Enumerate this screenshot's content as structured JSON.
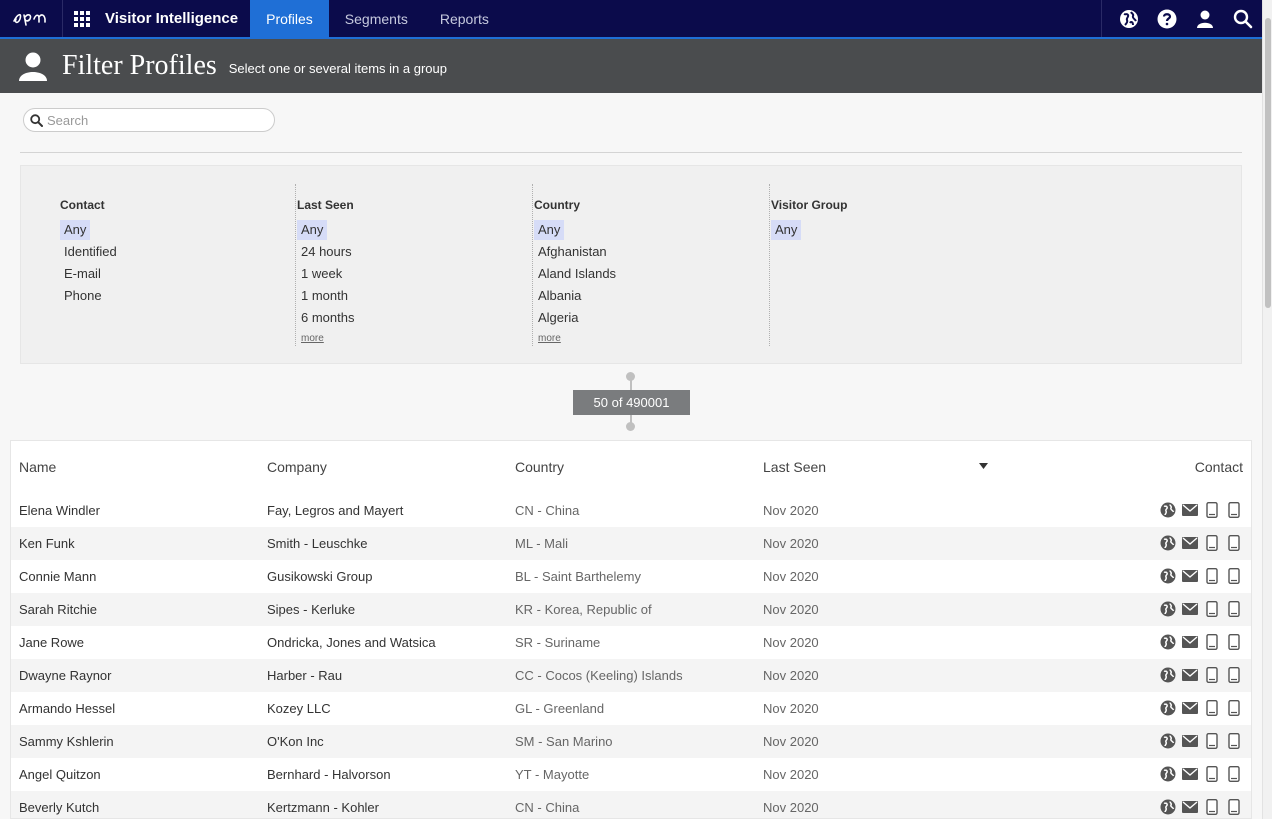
{
  "nav": {
    "product": "Visitor Intelligence",
    "tabs": [
      {
        "label": "Profiles",
        "active": true
      },
      {
        "label": "Segments",
        "active": false
      },
      {
        "label": "Reports",
        "active": false
      }
    ],
    "icons": [
      "globe-icon",
      "help-icon",
      "user-icon",
      "search-icon"
    ]
  },
  "header": {
    "title": "Filter Profiles",
    "subtitle": "Select one or several items in a group"
  },
  "search": {
    "placeholder": "Search",
    "value": ""
  },
  "filters": [
    {
      "title": "Contact",
      "items": [
        "Any",
        "Identified",
        "E-mail",
        "Phone"
      ],
      "selected": "Any",
      "more": ""
    },
    {
      "title": "Last Seen",
      "items": [
        "Any",
        "24 hours",
        "1 week",
        "1 month",
        "6 months"
      ],
      "selected": "Any",
      "more": "more"
    },
    {
      "title": "Country",
      "items": [
        "Any",
        "Afghanistan",
        "Aland Islands",
        "Albania",
        "Algeria"
      ],
      "selected": "Any",
      "more": "more"
    },
    {
      "title": "Visitor Group",
      "items": [
        "Any"
      ],
      "selected": "Any",
      "more": ""
    }
  ],
  "counter": "50 of 490001",
  "table": {
    "headers": {
      "name": "Name",
      "company": "Company",
      "country": "Country",
      "last_seen": "Last Seen",
      "contact": "Contact"
    },
    "rows": [
      {
        "name": "Elena Windler",
        "company": "Fay, Legros and Mayert",
        "country": "CN - China",
        "last_seen": "Nov 2020"
      },
      {
        "name": "Ken Funk",
        "company": "Smith - Leuschke",
        "country": "ML - Mali",
        "last_seen": "Nov 2020"
      },
      {
        "name": "Connie Mann",
        "company": "Gusikowski Group",
        "country": "BL - Saint Barthelemy",
        "last_seen": "Nov 2020"
      },
      {
        "name": "Sarah Ritchie",
        "company": "Sipes - Kerluke",
        "country": "KR - Korea, Republic of",
        "last_seen": "Nov 2020"
      },
      {
        "name": "Jane Rowe",
        "company": "Ondricka, Jones and Watsica",
        "country": "SR - Suriname",
        "last_seen": "Nov 2020"
      },
      {
        "name": "Dwayne Raynor",
        "company": "Harber - Rau",
        "country": "CC - Cocos (Keeling) Islands",
        "last_seen": "Nov 2020"
      },
      {
        "name": "Armando Hessel",
        "company": "Kozey LLC",
        "country": "GL - Greenland",
        "last_seen": "Nov 2020"
      },
      {
        "name": "Sammy Kshlerin",
        "company": "O'Kon Inc",
        "country": "SM - San Marino",
        "last_seen": "Nov 2020"
      },
      {
        "name": "Angel Quitzon",
        "company": "Bernhard - Halvorson",
        "country": "YT - Mayotte",
        "last_seen": "Nov 2020"
      },
      {
        "name": "Beverly Kutch",
        "company": "Kertzmann - Kohler",
        "country": "CN - China",
        "last_seen": "Nov 2020"
      }
    ]
  },
  "colors": {
    "nav_bg": "#0b0b4b",
    "accent": "#1f6fd6",
    "header_bg": "#4a4c4e",
    "selected_filter": "#d6dcf7"
  }
}
